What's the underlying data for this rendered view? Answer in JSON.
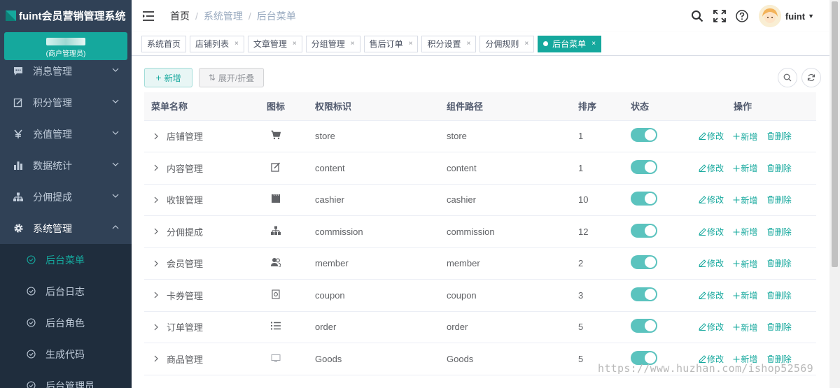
{
  "app": {
    "title": "fuint会员营销管理系统"
  },
  "user_card": {
    "name": "A",
    "role": "(商户管理员)"
  },
  "sidebar": {
    "items": [
      {
        "label": "消息管理",
        "icon": "message-icon"
      },
      {
        "label": "积分管理",
        "icon": "edit-icon"
      },
      {
        "label": "充值管理",
        "icon": "yen-icon"
      },
      {
        "label": "数据统计",
        "icon": "bar-chart-icon"
      },
      {
        "label": "分佣提成",
        "icon": "hierarchy-icon"
      },
      {
        "label": "系统管理",
        "icon": "gear-icon"
      }
    ],
    "subitems": [
      {
        "label": "后台菜单",
        "active": true
      },
      {
        "label": "后台日志"
      },
      {
        "label": "后台角色"
      },
      {
        "label": "生成代码"
      },
      {
        "label": "后台管理员"
      }
    ]
  },
  "breadcrumb": [
    "首页",
    "系统管理",
    "后台菜单"
  ],
  "header": {
    "username": "fuint"
  },
  "tags": [
    {
      "label": "系统首页",
      "closable": false
    },
    {
      "label": "店铺列表",
      "closable": true
    },
    {
      "label": "文章管理",
      "closable": true
    },
    {
      "label": "分组管理",
      "closable": true
    },
    {
      "label": "售后订单",
      "closable": true
    },
    {
      "label": "积分设置",
      "closable": true
    },
    {
      "label": "分佣规则",
      "closable": true
    },
    {
      "label": "后台菜单",
      "closable": true,
      "active": true
    }
  ],
  "toolbar": {
    "add_label": "新增",
    "expand_label": "展开/折叠"
  },
  "table": {
    "headers": {
      "name": "菜单名称",
      "icon": "图标",
      "perm": "权限标识",
      "path": "组件路径",
      "sort": "排序",
      "status": "状态",
      "ops": "操作"
    },
    "rows": [
      {
        "name": "店铺管理",
        "icon": "cart-icon",
        "perm": "store",
        "path": "store",
        "sort": "1"
      },
      {
        "name": "内容管理",
        "icon": "edit-icon",
        "perm": "content",
        "path": "content",
        "sort": "1"
      },
      {
        "name": "收银管理",
        "icon": "clapperboard-icon",
        "perm": "cashier",
        "path": "cashier",
        "sort": "10"
      },
      {
        "name": "分佣提成",
        "icon": "hierarchy-icon",
        "perm": "commission",
        "path": "commission",
        "sort": "12"
      },
      {
        "name": "会员管理",
        "icon": "users-icon",
        "perm": "member",
        "path": "member",
        "sort": "2"
      },
      {
        "name": "卡券管理",
        "icon": "coupon-icon",
        "perm": "coupon",
        "path": "coupon",
        "sort": "3"
      },
      {
        "name": "订单管理",
        "icon": "list-icon",
        "perm": "order",
        "path": "order",
        "sort": "5"
      },
      {
        "name": "商品管理",
        "icon": "monitor-icon",
        "perm": "Goods",
        "path": "Goods",
        "sort": "5"
      }
    ],
    "ops": {
      "edit": "修改",
      "add": "新增",
      "delete": "删除"
    }
  },
  "watermark": "https://www.huzhan.com/ishop52569",
  "colors": {
    "accent": "#15a89d",
    "sidebar": "#304156",
    "sidebar_sub": "#1f2d3d"
  }
}
